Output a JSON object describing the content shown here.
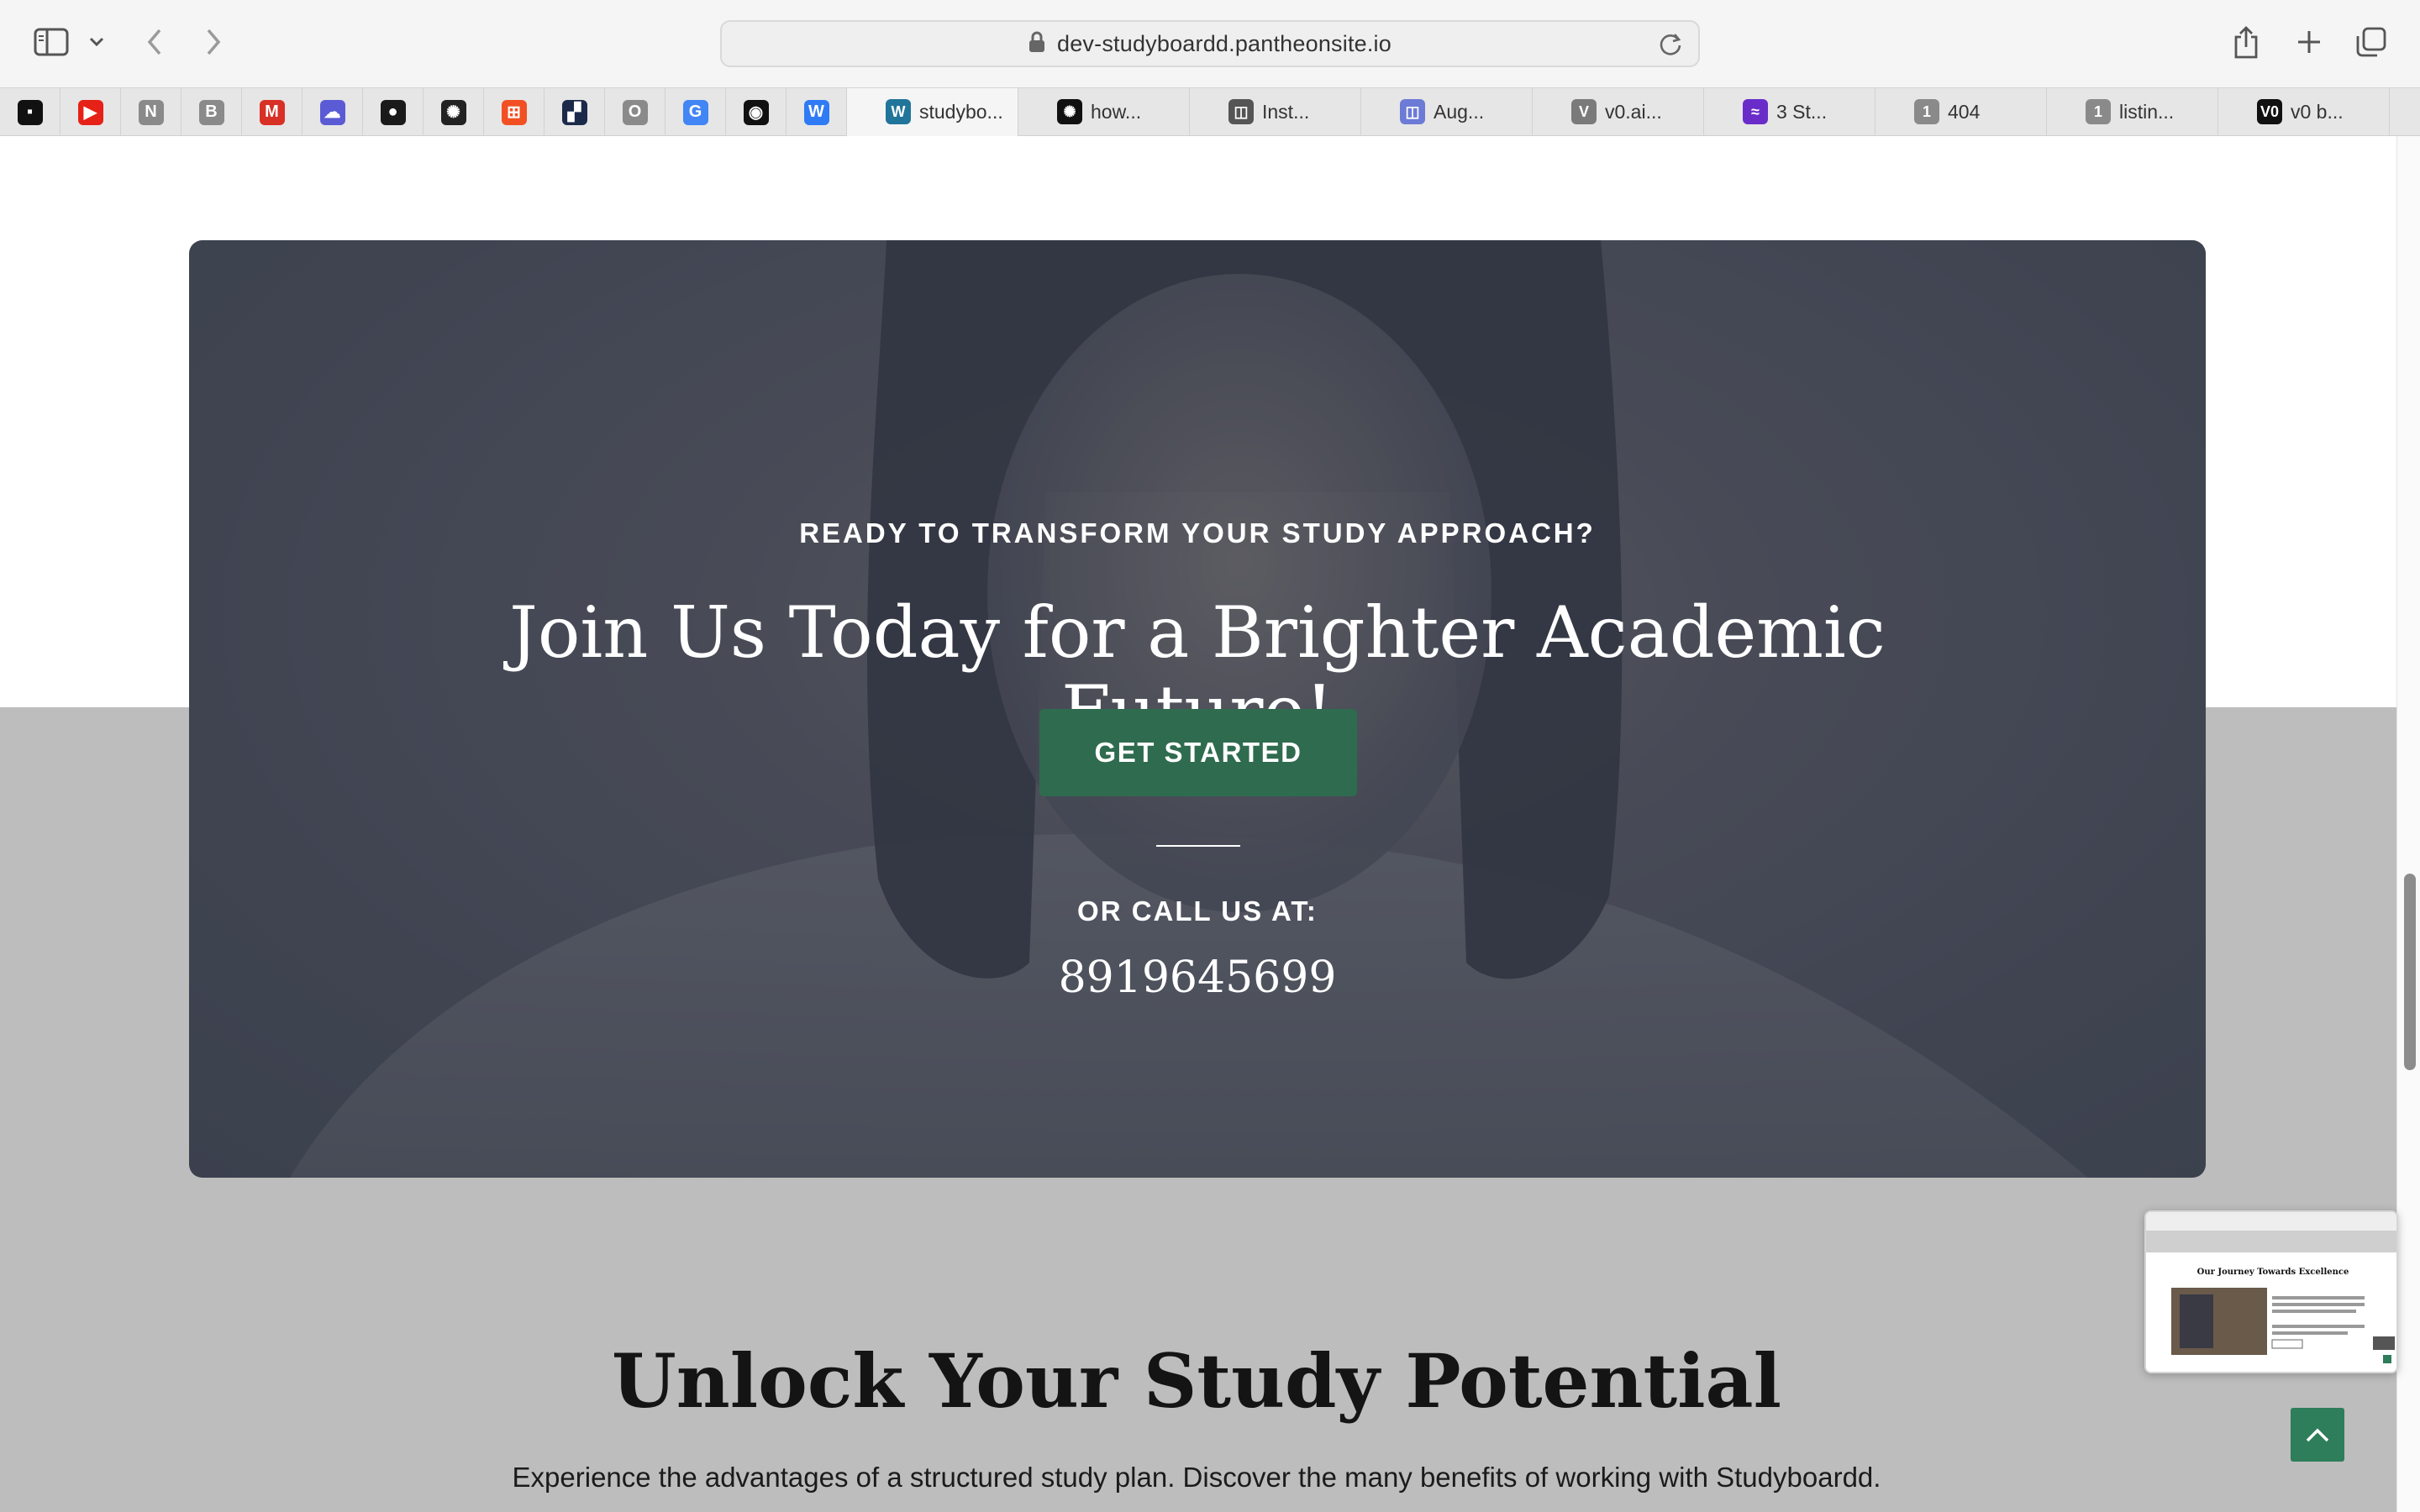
{
  "browser": {
    "url": "dev-studyboardd.pantheonsite.io",
    "pinned": [
      {
        "name": "pinned-site-1",
        "glyph": "▪",
        "color": "#111111"
      },
      {
        "name": "youtube",
        "glyph": "▶",
        "color": "#e62117"
      },
      {
        "name": "notion",
        "glyph": "N",
        "color": "#8a8a8a"
      },
      {
        "name": "pinned-b",
        "glyph": "B",
        "color": "#8a8a8a"
      },
      {
        "name": "gmail",
        "glyph": "M",
        "color": "#d93025"
      },
      {
        "name": "cloud",
        "glyph": "☁",
        "color": "#5b5bd6"
      },
      {
        "name": "github",
        "glyph": "●",
        "color": "#1a1a1a"
      },
      {
        "name": "openai",
        "glyph": "✺",
        "color": "#222222"
      },
      {
        "name": "microsoft",
        "glyph": "⊞",
        "color": "#f25022"
      },
      {
        "name": "pinned-dark",
        "glyph": "▞",
        "color": "#1b2a4a"
      },
      {
        "name": "pinned-o",
        "glyph": "O",
        "color": "#8a8a8a"
      },
      {
        "name": "google",
        "glyph": "G",
        "color": "#4285f4"
      },
      {
        "name": "pinned-black",
        "glyph": "◉",
        "color": "#111111"
      },
      {
        "name": "pinned-w",
        "glyph": "W",
        "color": "#2f7bf5"
      }
    ],
    "tabs": [
      {
        "label": "studybo...",
        "glyph": "W",
        "color": "#21759b",
        "active": true
      },
      {
        "label": "how...",
        "glyph": "✺",
        "color": "#111111"
      },
      {
        "label": "Inst...",
        "glyph": "◫",
        "color": "#555555"
      },
      {
        "label": "Aug...",
        "glyph": "◫",
        "color": "#6c7bd6"
      },
      {
        "label": "v0.ai...",
        "glyph": "V",
        "color": "#7a7a7a"
      },
      {
        "label": "3 St...",
        "glyph": "≈",
        "color": "#6a2cc9"
      },
      {
        "label": "404",
        "glyph": "1",
        "color": "#8a8a8a"
      },
      {
        "label": "listin...",
        "glyph": "1",
        "color": "#8a8a8a"
      },
      {
        "label": "v0 b...",
        "glyph": "V0",
        "color": "#111111"
      }
    ]
  },
  "hero": {
    "eyebrow": "READY TO TRANSFORM YOUR STUDY APPROACH?",
    "title": "Join Us Today for a Brighter Academic Future!",
    "cta_label": "GET STARTED",
    "call_label": "OR CALL US AT:",
    "phone": "8919645699",
    "cta_color": "#2f6b4f"
  },
  "section": {
    "title": "Unlock Your Study Potential",
    "subtitle": "Experience the advantages of a structured study plan. Discover the many benefits of working with Studyboardd."
  },
  "preview": {
    "title": "Our Journey Towards Excellence"
  }
}
